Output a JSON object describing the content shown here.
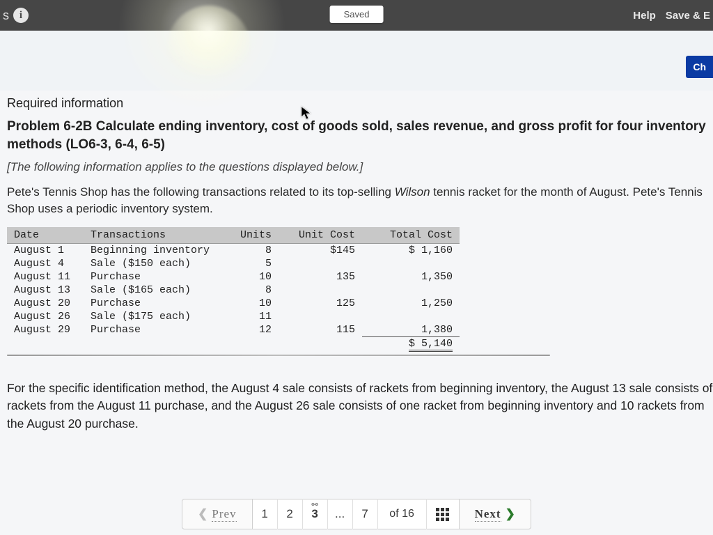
{
  "topbar": {
    "left_letter": "s",
    "info_glyph": "i",
    "saved_label": "Saved",
    "help_label": "Help",
    "save_exit_label": "Save & E"
  },
  "subhead": {
    "ch_label": "Ch"
  },
  "content": {
    "required_info": "Required information",
    "problem_title": "Problem 6-2B Calculate ending inventory, cost of goods sold, sales revenue, and gross profit for four inventory methods (LO6-3, 6-4, 6-5)",
    "italic_note": "[The following information applies to the questions displayed below.]",
    "intro_1": "Pete's Tennis Shop has the following transactions related to its top-selling ",
    "intro_em": "Wilson",
    "intro_2": " tennis racket for the month of August. Pete's Tennis Shop uses a periodic inventory system.",
    "below": "For the specific identification method, the August 4 sale consists of rackets from beginning inventory, the August 13 sale consists of rackets from the August 11 purchase, and the August 26 sale consists of one racket from beginning inventory and 10 rackets from the August 20 purchase."
  },
  "table": {
    "headers": {
      "date": "Date",
      "tx": "Transactions",
      "units": "Units",
      "unit_cost": "Unit Cost",
      "total_cost": "Total Cost"
    },
    "rows": [
      {
        "date": "August  1",
        "tx": "Beginning inventory",
        "units": "8",
        "unit_cost": "$145",
        "total_cost": "$   1,160"
      },
      {
        "date": "August  4",
        "tx": "Sale ($150 each)",
        "units": "5",
        "unit_cost": "",
        "total_cost": ""
      },
      {
        "date": "August 11",
        "tx": "Purchase",
        "units": "10",
        "unit_cost": "135",
        "total_cost": "1,350"
      },
      {
        "date": "August 13",
        "tx": "Sale ($165 each)",
        "units": "8",
        "unit_cost": "",
        "total_cost": ""
      },
      {
        "date": "August 20",
        "tx": "Purchase",
        "units": "10",
        "unit_cost": "125",
        "total_cost": "1,250"
      },
      {
        "date": "August 26",
        "tx": "Sale ($175 each)",
        "units": "11",
        "unit_cost": "",
        "total_cost": ""
      },
      {
        "date": "August 29",
        "tx": "Purchase",
        "units": "12",
        "unit_cost": "115",
        "total_cost": "1,380"
      }
    ],
    "total_label": "$   5,140"
  },
  "pager": {
    "prev": "Prev",
    "next": "Next",
    "pages": [
      "1",
      "2",
      "3",
      "...",
      "7"
    ],
    "active_index": 2,
    "of_label": "of 16"
  }
}
